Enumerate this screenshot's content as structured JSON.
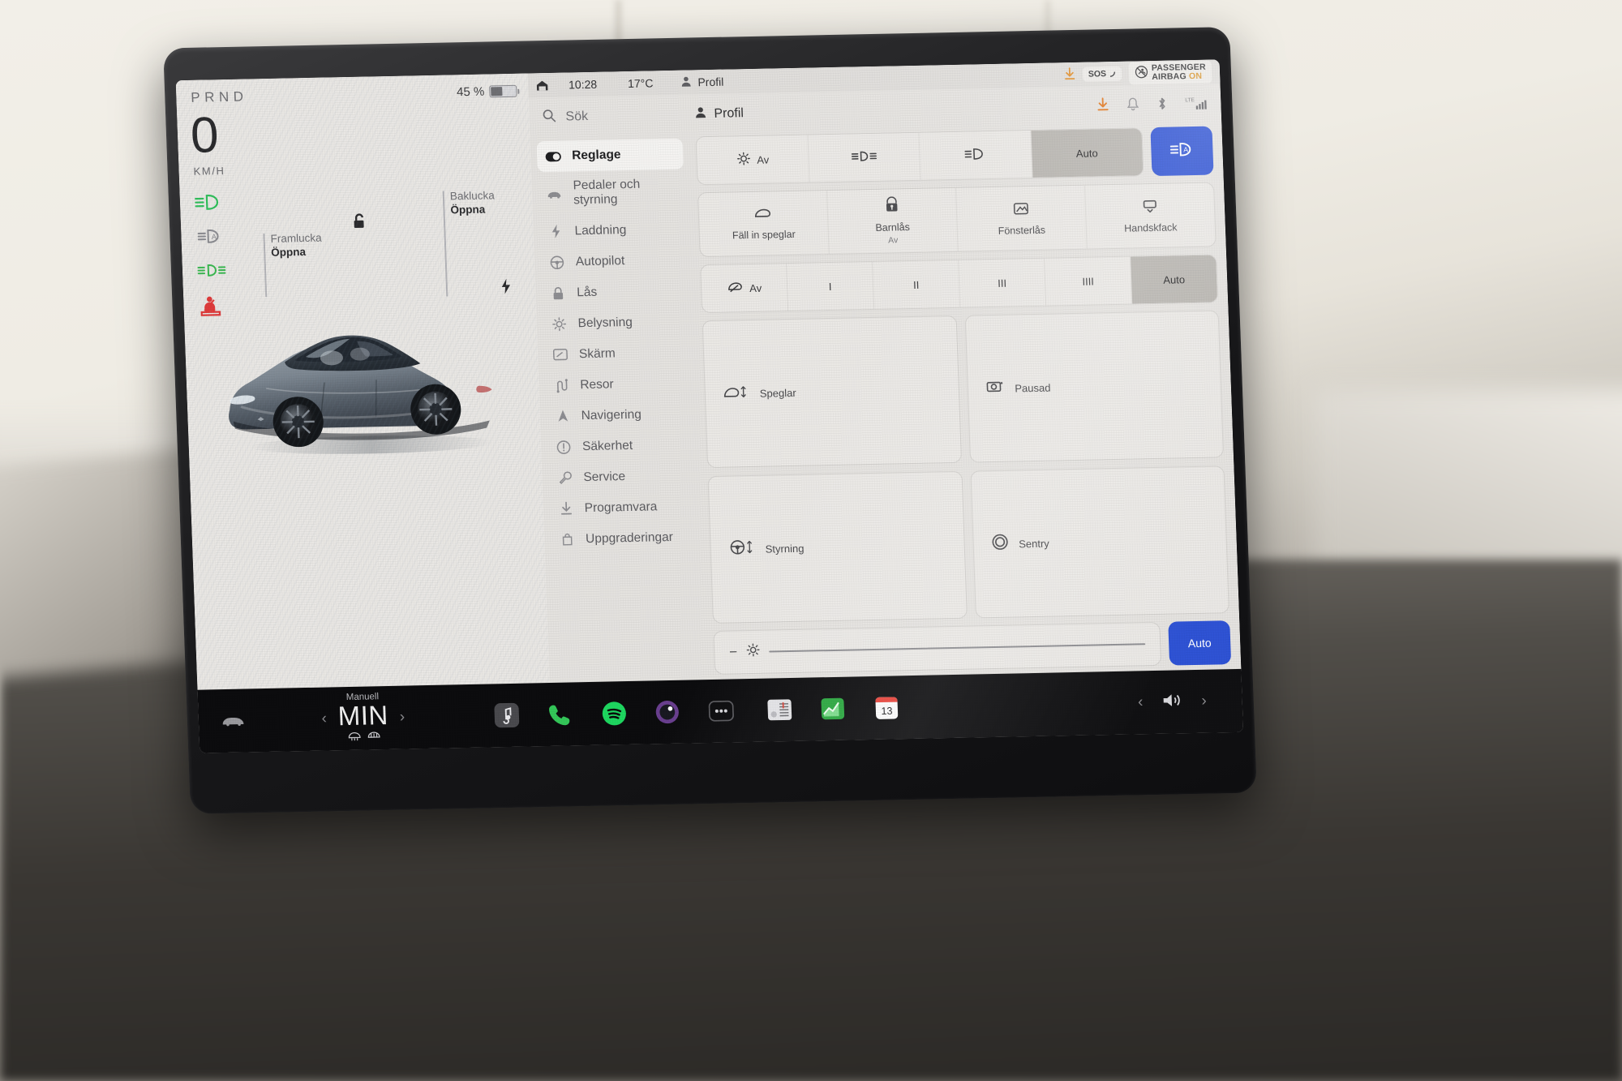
{
  "drive": {
    "gear_indicator": "PRND",
    "speed": "0",
    "speed_unit": "KM/H",
    "battery_percent": "45 %",
    "battery_level": 45,
    "telltales": [
      {
        "name": "low-beam-telltale",
        "color": "#2fbf5a"
      },
      {
        "name": "auto-high-beam-telltale",
        "color": "#8b8b90"
      },
      {
        "name": "parking-lights-telltale",
        "color": "#39b84f"
      },
      {
        "name": "seatbelt-warning-telltale",
        "color": "#e03a3a"
      }
    ],
    "callouts": [
      {
        "name": "front-trunk",
        "title": "Framlucka",
        "value": "Öppna"
      },
      {
        "name": "rear-trunk",
        "title": "Baklucka",
        "value": "Öppna"
      }
    ]
  },
  "statusbar": {
    "garage_icon": "garage-icon",
    "time": "10:28",
    "temperature": "17°C",
    "profile": "Profil",
    "download_icon": "download-icon",
    "sos_label": "SOS",
    "airbag_line1": "PASSENGER",
    "airbag_line2": "AIRBAG",
    "airbag_state": "ON"
  },
  "panel_header": {
    "search_placeholder": "Sök",
    "profile_label": "Profil",
    "icons": [
      "download-icon",
      "bell-icon",
      "bluetooth-icon",
      "lte-signal-icon"
    ],
    "lte_label": "LTE"
  },
  "menu": {
    "items": [
      {
        "label": "Reglage",
        "icon": "toggle-icon",
        "selected": true
      },
      {
        "label": "Pedaler och styrning",
        "icon": "car-icon",
        "selected": false
      },
      {
        "label": "Laddning",
        "icon": "bolt-icon",
        "selected": false
      },
      {
        "label": "Autopilot",
        "icon": "steering-wheel-icon",
        "selected": false
      },
      {
        "label": "Lås",
        "icon": "lock-icon",
        "selected": false
      },
      {
        "label": "Belysning",
        "icon": "sun-icon",
        "selected": false
      },
      {
        "label": "Skärm",
        "icon": "display-icon",
        "selected": false
      },
      {
        "label": "Resor",
        "icon": "trip-icon",
        "selected": false
      },
      {
        "label": "Navigering",
        "icon": "navigation-arrow-icon",
        "selected": false
      },
      {
        "label": "Säkerhet",
        "icon": "alert-circle-icon",
        "selected": false
      },
      {
        "label": "Service",
        "icon": "wrench-icon",
        "selected": false
      },
      {
        "label": "Programvara",
        "icon": "download-icon",
        "selected": false
      },
      {
        "label": "Uppgraderingar",
        "icon": "bag-icon",
        "selected": false
      }
    ]
  },
  "controls": {
    "headlights": {
      "options": [
        {
          "label": "Av",
          "icon": "lamp-off-icon",
          "selected": false
        },
        {
          "label": "",
          "icon": "parking-lights-icon",
          "selected": false
        },
        {
          "label": "",
          "icon": "low-beam-icon",
          "selected": false
        },
        {
          "label": "Auto",
          "icon": "",
          "selected": true
        }
      ],
      "auto_highbeam": {
        "label": "",
        "icon": "auto-high-beam-icon",
        "active": true,
        "color": "#2b50d4"
      }
    },
    "quick_tiles": [
      {
        "label": "Fäll in speglar",
        "sub": "",
        "icon": "mirror-icon"
      },
      {
        "label": "Barnlås",
        "sub": "Av",
        "icon": "child-lock-icon"
      },
      {
        "label": "Fönsterlås",
        "sub": "",
        "icon": "window-lock-icon"
      },
      {
        "label": "Handskfack",
        "sub": "",
        "icon": "glovebox-icon"
      }
    ],
    "wipers": {
      "options": [
        {
          "label": "Av",
          "icon": "wiper-icon",
          "selected": false
        },
        {
          "label": "I",
          "icon": "",
          "selected": false
        },
        {
          "label": "II",
          "icon": "",
          "selected": false
        },
        {
          "label": "III",
          "icon": "",
          "selected": false
        },
        {
          "label": "IIII",
          "icon": "",
          "selected": false
        },
        {
          "label": "Auto",
          "icon": "",
          "selected": true
        }
      ]
    },
    "adjust_left": [
      {
        "label": "Speglar",
        "icon": "mirror-adjust-icon"
      },
      {
        "label": "Styrning",
        "icon": "steering-adjust-icon"
      }
    ],
    "adjust_right": [
      {
        "label": "Pausad",
        "icon": "dashcam-icon"
      },
      {
        "label": "Sentry",
        "icon": "sentry-icon"
      }
    ],
    "brightness": {
      "icon": "brightness-icon",
      "minus": "−",
      "value": 2,
      "auto_label": "Auto",
      "auto_color": "#2b50d4"
    }
  },
  "bottombar": {
    "car_icon": "car-icon",
    "climate": {
      "mode": "Manuell",
      "temperature": "MIN",
      "prev": "‹",
      "next": "›",
      "defrost_icons": [
        "front-defrost-icon",
        "rear-defrost-icon"
      ]
    },
    "apps": [
      {
        "name": "media-app-icon",
        "label": "media"
      },
      {
        "name": "phone-app-icon",
        "label": "phone"
      },
      {
        "name": "spotify-app-icon",
        "label": "spotify"
      },
      {
        "name": "camera-app-icon",
        "label": "camera"
      },
      {
        "name": "more-apps-icon",
        "label": "more"
      }
    ],
    "widgets": [
      {
        "name": "tuner-widget-icon",
        "label": "tuner"
      },
      {
        "name": "stocks-widget-icon",
        "label": "stocks"
      },
      {
        "name": "calendar-widget-icon",
        "label": "calendar",
        "day": "13"
      }
    ],
    "volume": {
      "icon": "volume-icon",
      "prev": "‹",
      "next": "›"
    }
  }
}
